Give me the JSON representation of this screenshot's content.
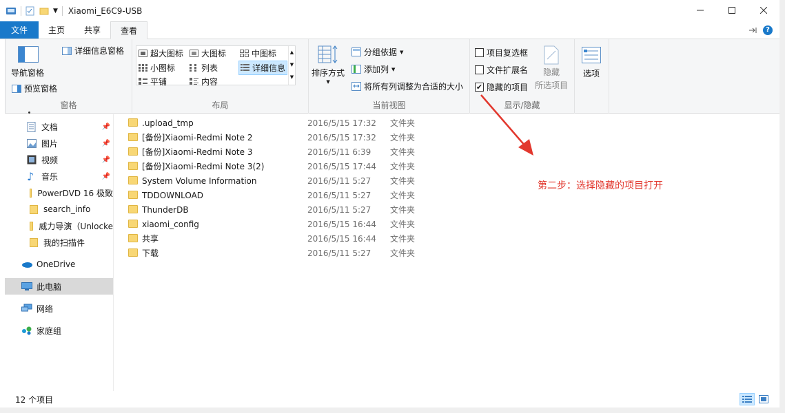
{
  "window": {
    "title": "Xiaomi_E6C9-USB"
  },
  "tabs": [
    {
      "label": "文件"
    },
    {
      "label": "主页"
    },
    {
      "label": "共享"
    },
    {
      "label": "查看"
    }
  ],
  "ribbon": {
    "pane": {
      "nav_pane": "导航窗格",
      "details_pane": "详细信息窗格",
      "preview_pane": "预览窗格",
      "group": "窗格"
    },
    "layout": {
      "items": [
        "超大图标",
        "大图标",
        "中图标",
        "小图标",
        "列表",
        "详细信息",
        "平铺",
        "内容"
      ],
      "group": "布局"
    },
    "current_view": {
      "sort": "排序方式",
      "group_by": "分组依据",
      "add_column": "添加列",
      "fit_columns": "将所有列调整为合适的大小",
      "group": "当前视图"
    },
    "show_hide": {
      "item_checkbox": "项目复选框",
      "file_ext": "文件扩展名",
      "hidden_items": "隐藏的项目",
      "hide_selected_1": "隐藏",
      "hide_selected_2": "所选项目",
      "group": "显示/隐藏"
    },
    "options": {
      "label": "选项"
    }
  },
  "nav": {
    "items": [
      {
        "label": "文档"
      },
      {
        "label": "图片"
      },
      {
        "label": "视频"
      },
      {
        "label": "音乐"
      },
      {
        "label": "PowerDVD 16 极致"
      },
      {
        "label": "search_info"
      },
      {
        "label": "威力导演（Unlocke"
      },
      {
        "label": "我的扫描件"
      },
      {
        "label": "OneDrive"
      },
      {
        "label": "此电脑"
      },
      {
        "label": "网络"
      },
      {
        "label": "家庭组"
      }
    ]
  },
  "files": [
    {
      "name": ".upload_tmp",
      "date": "2016/5/15 17:32",
      "type": "文件夹"
    },
    {
      "name": "[备份]Xiaomi-Redmi Note 2",
      "date": "2016/5/15 17:32",
      "type": "文件夹"
    },
    {
      "name": "[备份]Xiaomi-Redmi Note 3",
      "date": "2016/5/11 6:39",
      "type": "文件夹"
    },
    {
      "name": "[备份]Xiaomi-Redmi Note 3(2)",
      "date": "2016/5/15 17:44",
      "type": "文件夹"
    },
    {
      "name": "System Volume Information",
      "date": "2016/5/11 5:27",
      "type": "文件夹"
    },
    {
      "name": "TDDOWNLOAD",
      "date": "2016/5/11 5:27",
      "type": "文件夹"
    },
    {
      "name": "ThunderDB",
      "date": "2016/5/11 5:27",
      "type": "文件夹"
    },
    {
      "name": "xiaomi_config",
      "date": "2016/5/15 16:44",
      "type": "文件夹"
    },
    {
      "name": "共享",
      "date": "2016/5/15 16:44",
      "type": "文件夹"
    },
    {
      "name": "下载",
      "date": "2016/5/11 5:27",
      "type": "文件夹"
    }
  ],
  "status": {
    "count": "12 个项目"
  },
  "annotation": {
    "text": "第二步：选择隐藏的项目打开"
  },
  "colors": {
    "accent": "#1979ca",
    "annotation": "#e2382e",
    "folder": "#f8d775"
  }
}
